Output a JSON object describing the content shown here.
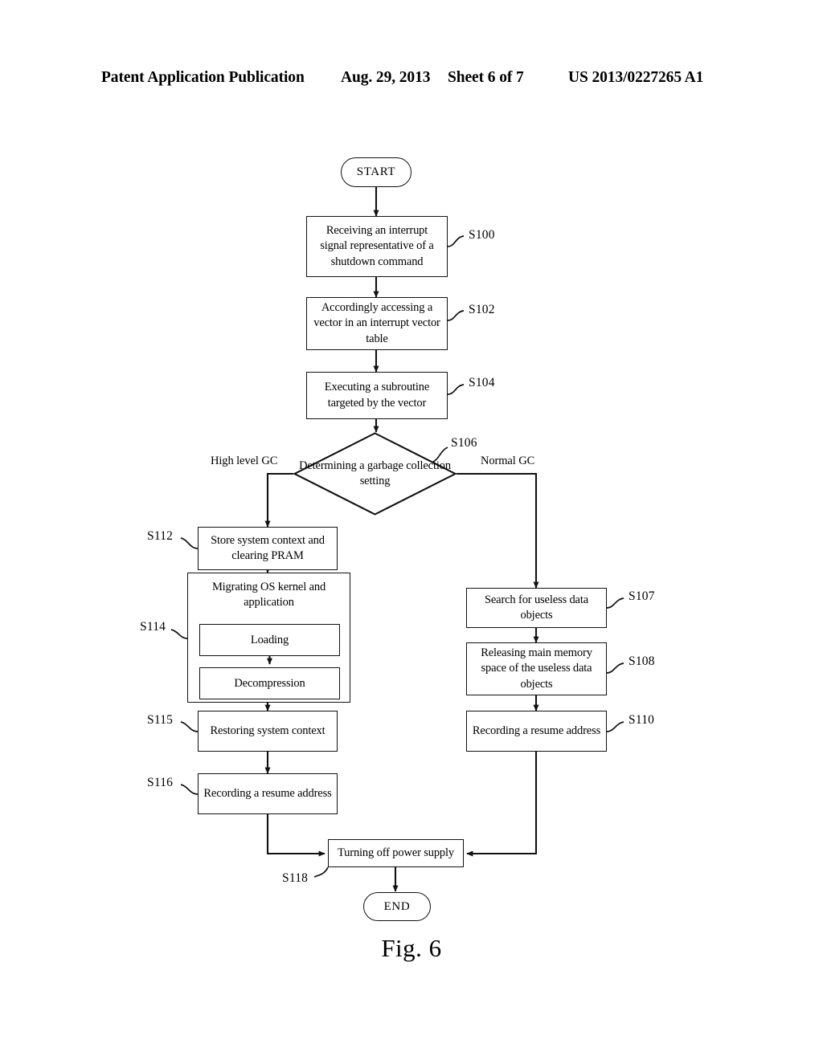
{
  "header": {
    "publication": "Patent Application Publication",
    "date": "Aug. 29, 2013",
    "sheet": "Sheet 6 of 7",
    "patent_number": "US 2013/0227265 A1"
  },
  "figure": {
    "caption": "Fig. 6"
  },
  "flowchart": {
    "start": {
      "label": "START"
    },
    "end": {
      "label": "END"
    },
    "nodes": {
      "s100": {
        "label": "Receiving an interrupt signal representative of a shutdown command",
        "ref": "S100"
      },
      "s102": {
        "label": "Accordingly accessing a vector in an interrupt vector table",
        "ref": "S102"
      },
      "s104": {
        "label": "Executing a subroutine targeted by the vector",
        "ref": "S104"
      },
      "s106": {
        "label": "Determining a garbage collection setting",
        "ref": "S106"
      },
      "s112": {
        "label": "Store system context and clearing PRAM",
        "ref": "S112"
      },
      "s114": {
        "label": "Migrating OS kernel and application",
        "ref": "S114",
        "sub": [
          {
            "label": "Loading"
          },
          {
            "label": "Decompression"
          }
        ]
      },
      "s115": {
        "label": "Restoring system context",
        "ref": "S115"
      },
      "s116": {
        "label": "Recording a resume address",
        "ref": "S116"
      },
      "s107": {
        "label": "Search for useless data objects",
        "ref": "S107"
      },
      "s108": {
        "label": "Releasing main memory space of the useless data objects",
        "ref": "S108"
      },
      "s110": {
        "label": "Recording a resume address",
        "ref": "S110"
      },
      "s118": {
        "label": "Turning off power supply",
        "ref": "S118"
      }
    },
    "branches": {
      "left": {
        "label": "High level GC"
      },
      "right": {
        "label": "Normal GC"
      }
    }
  }
}
